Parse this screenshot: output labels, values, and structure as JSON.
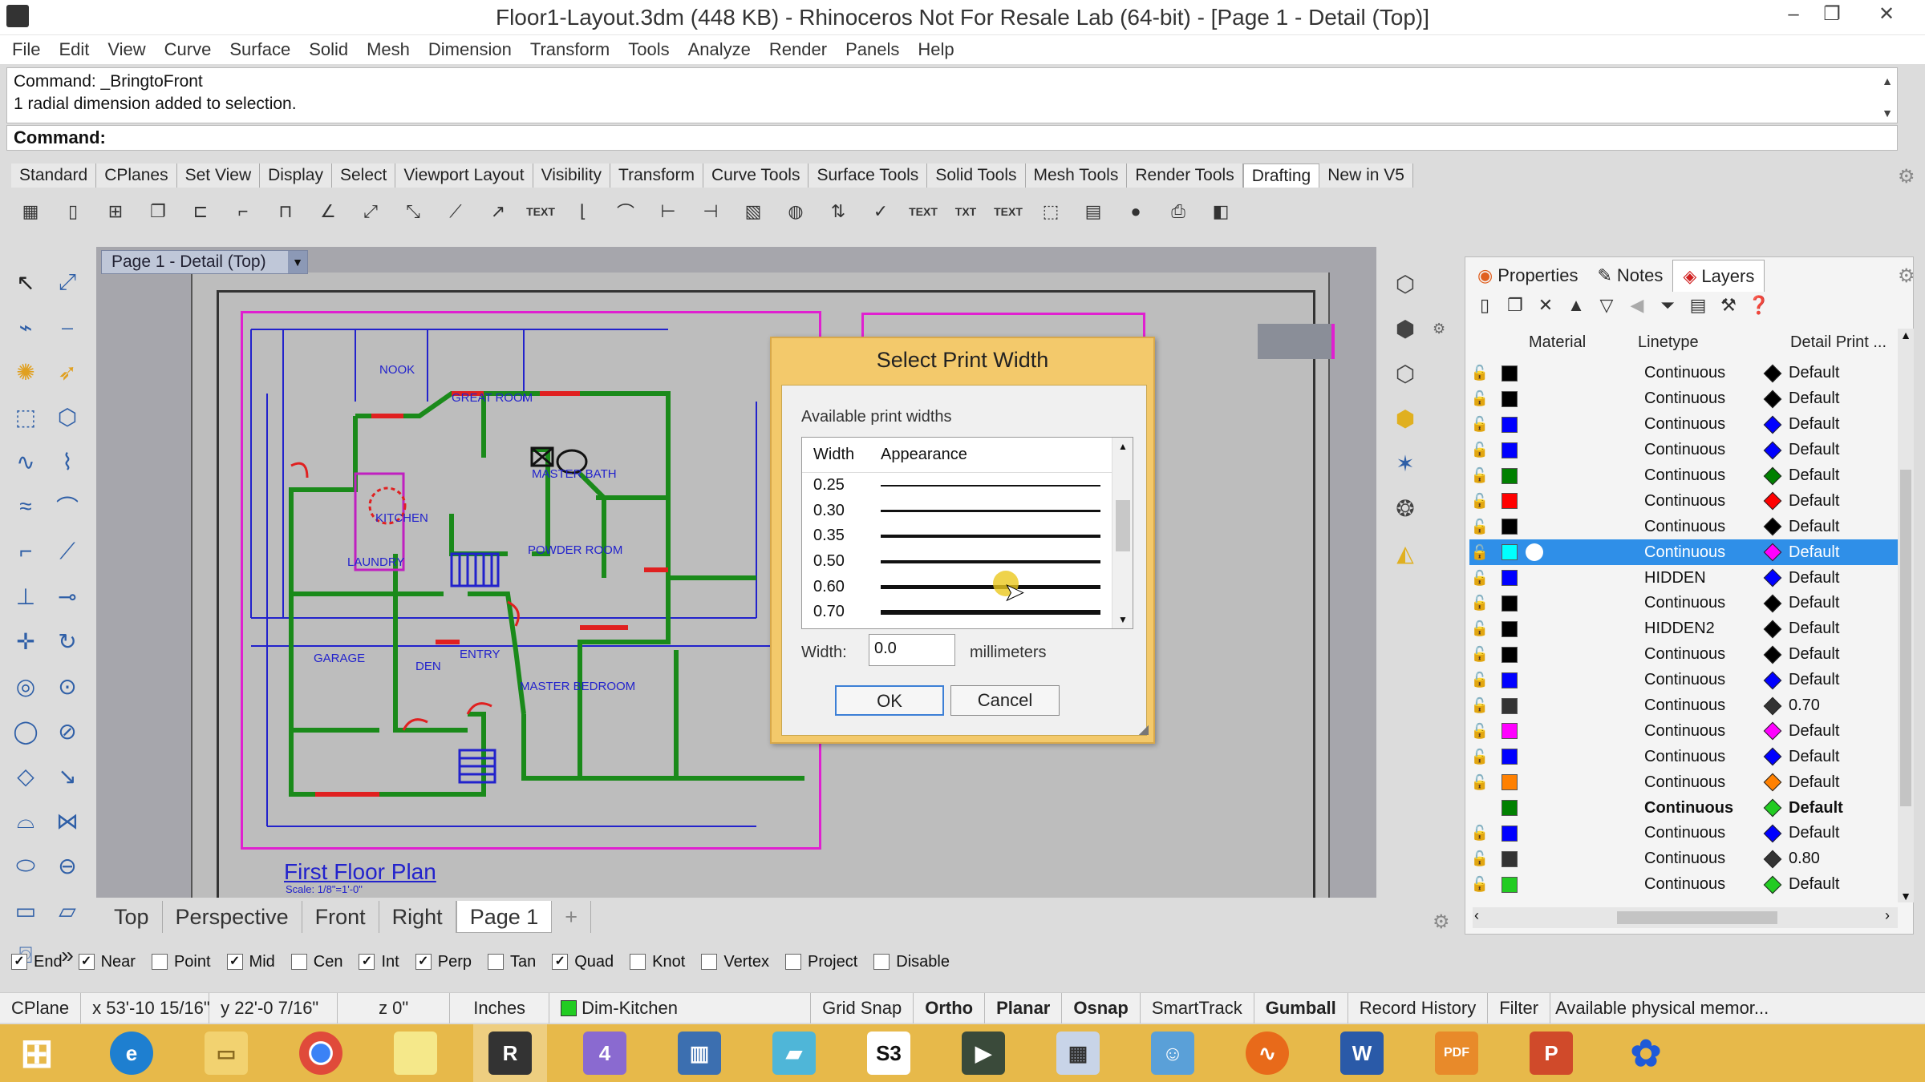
{
  "window": {
    "title": "Floor1-Layout.3dm (448 KB) - Rhinoceros Not For Resale Lab (64-bit) - [Page 1 - Detail (Top)]",
    "minimize": "–",
    "maximize": "❐",
    "close": "✕"
  },
  "menu": [
    "File",
    "Edit",
    "View",
    "Curve",
    "Surface",
    "Solid",
    "Mesh",
    "Dimension",
    "Transform",
    "Tools",
    "Analyze",
    "Render",
    "Panels",
    "Help"
  ],
  "command": {
    "history": [
      "Command: _BringtoFront",
      "1 radial dimension added to selection."
    ],
    "prompt": "Command:"
  },
  "toolbar_tabs": [
    "Standard",
    "CPlanes",
    "Set View",
    "Display",
    "Select",
    "Viewport Layout",
    "Visibility",
    "Transform",
    "Curve Tools",
    "Surface Tools",
    "Solid Tools",
    "Mesh Tools",
    "Render Tools",
    "Drafting",
    "New in V5"
  ],
  "active_toolbar_tab": "Drafting",
  "viewport": {
    "title": "Page 1 - Detail (Top)",
    "plan_title": "First Floor Plan",
    "plan_scale": "Scale: 1/8\"=1'-0\"",
    "rooms": [
      "NOOK",
      "GREAT ROOM",
      "KITCHEN",
      "MASTER BATH",
      "POWDER ROOM",
      "LAUNDRY",
      "GARAGE",
      "DEN",
      "ENTRY",
      "MASTER BEDROOM"
    ]
  },
  "viewport_tabs": [
    "Top",
    "Perspective",
    "Front",
    "Right",
    "Page 1"
  ],
  "active_viewport_tab": "Page 1",
  "add_tab": "+",
  "osnap": [
    {
      "label": "End",
      "checked": true
    },
    {
      "label": "Near",
      "checked": true
    },
    {
      "label": "Point",
      "checked": false
    },
    {
      "label": "Mid",
      "checked": true
    },
    {
      "label": "Cen",
      "checked": false
    },
    {
      "label": "Int",
      "checked": true
    },
    {
      "label": "Perp",
      "checked": true
    },
    {
      "label": "Tan",
      "checked": false
    },
    {
      "label": "Quad",
      "checked": true
    },
    {
      "label": "Knot",
      "checked": false
    },
    {
      "label": "Vertex",
      "checked": false
    },
    {
      "label": "Project",
      "checked": false
    },
    {
      "label": "Disable",
      "checked": false
    }
  ],
  "status": {
    "cplane": "CPlane",
    "x": "x 53'-10 15/16\"",
    "y": "y 22'-0 7/16\"",
    "z": "z 0\"",
    "units": "Inches",
    "layer": "Dim-Kitchen",
    "layer_color": "#22cc22",
    "grid_snap": "Grid Snap",
    "ortho": "Ortho",
    "planar": "Planar",
    "osnap": "Osnap",
    "smarttrack": "SmartTrack",
    "gumball": "Gumball",
    "record_history": "Record History",
    "filter": "Filter",
    "memory": "Available physical memor..."
  },
  "panel": {
    "tabs": [
      "Properties",
      "Notes",
      "Layers"
    ],
    "active_tab": "Layers",
    "columns": [
      "Material",
      "Linetype",
      "Detail Print ..."
    ],
    "layers": [
      {
        "color": "#000000",
        "linetype": "Continuous",
        "print_color": "#000000",
        "print_width": "Default"
      },
      {
        "color": "#000000",
        "linetype": "Continuous",
        "print_color": "#000000",
        "print_width": "Default"
      },
      {
        "color": "#0000ff",
        "linetype": "Continuous",
        "print_color": "#0000ff",
        "print_width": "Default"
      },
      {
        "color": "#0000ff",
        "linetype": "Continuous",
        "print_color": "#0000ff",
        "print_width": "Default"
      },
      {
        "color": "#008000",
        "linetype": "Continuous",
        "print_color": "#008000",
        "print_width": "Default"
      },
      {
        "color": "#ff0000",
        "linetype": "Continuous",
        "print_color": "#ff0000",
        "print_width": "Default"
      },
      {
        "color": "#000000",
        "linetype": "Continuous",
        "print_color": "#000000",
        "print_width": "Default"
      },
      {
        "color": "#00ffff",
        "linetype": "Continuous",
        "print_color": "#ff00ff",
        "print_width": "Default",
        "selected": true
      },
      {
        "color": "#0000ff",
        "linetype": "HIDDEN",
        "print_color": "#0000ff",
        "print_width": "Default"
      },
      {
        "color": "#000000",
        "linetype": "Continuous",
        "print_color": "#000000",
        "print_width": "Default"
      },
      {
        "color": "#000000",
        "linetype": "HIDDEN2",
        "print_color": "#000000",
        "print_width": "Default"
      },
      {
        "color": "#000000",
        "linetype": "Continuous",
        "print_color": "#000000",
        "print_width": "Default"
      },
      {
        "color": "#0000ff",
        "linetype": "Continuous",
        "print_color": "#0000ff",
        "print_width": "Default"
      },
      {
        "color": "#333333",
        "linetype": "Continuous",
        "print_color": "#333333",
        "print_width": "0.70"
      },
      {
        "color": "#ff00ff",
        "linetype": "Continuous",
        "print_color": "#ff00ff",
        "print_width": "Default"
      },
      {
        "color": "#0000ff",
        "linetype": "Continuous",
        "print_color": "#0000ff",
        "print_width": "Default"
      },
      {
        "color": "#ff8000",
        "linetype": "Continuous",
        "print_color": "#ff8000",
        "print_width": "Default"
      },
      {
        "color": "#008000",
        "linetype": "Continuous",
        "print_color": "#22cc22",
        "print_width": "Default",
        "bold": true
      },
      {
        "color": "#0000ff",
        "linetype": "Continuous",
        "print_color": "#0000ff",
        "print_width": "Default"
      },
      {
        "color": "#333333",
        "linetype": "Continuous",
        "print_color": "#333333",
        "print_width": "0.80"
      },
      {
        "color": "#22cc22",
        "linetype": "Continuous",
        "print_color": "#22cc22",
        "print_width": "Default"
      }
    ]
  },
  "dialog": {
    "title": "Select Print Width",
    "list_label": "Available print widths",
    "col_width": "Width",
    "col_appearance": "Appearance",
    "widths": [
      "0.25",
      "0.30",
      "0.35",
      "0.50",
      "0.60",
      "0.70"
    ],
    "width_label": "Width:",
    "width_value": "0.0",
    "unit": "millimeters",
    "ok": "OK",
    "cancel": "Cancel"
  }
}
